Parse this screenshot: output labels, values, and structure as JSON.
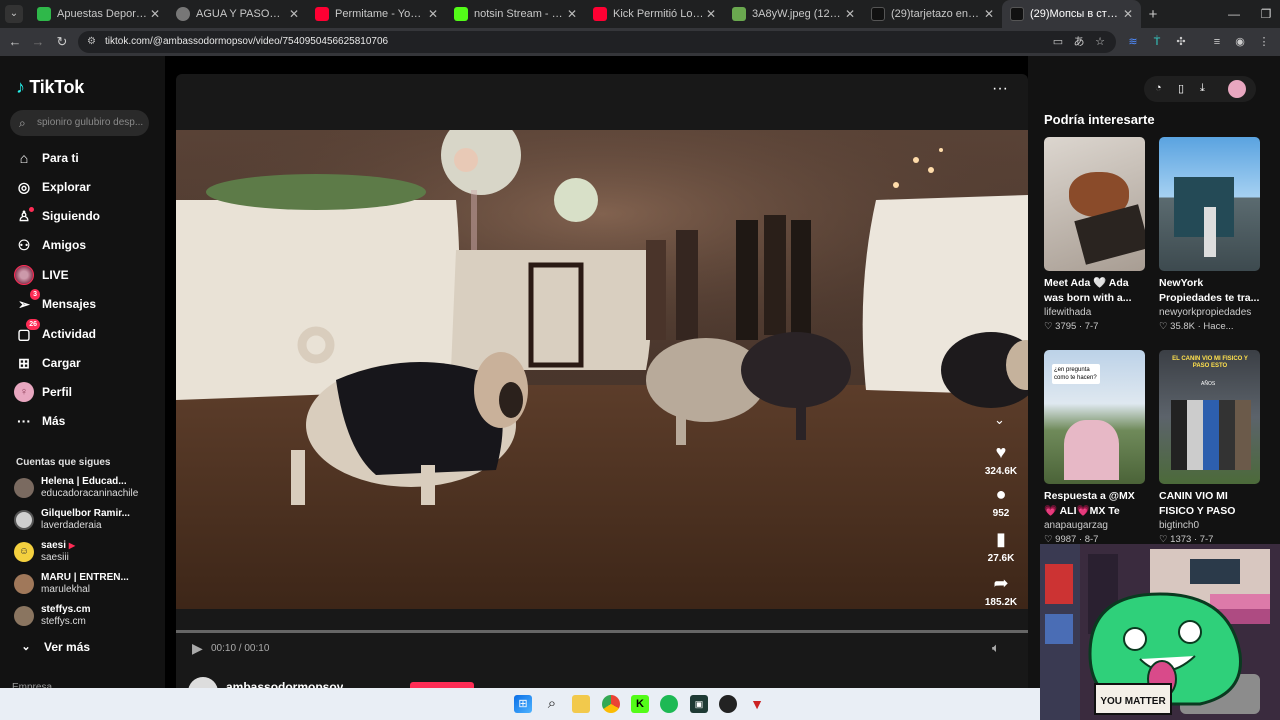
{
  "browser": {
    "tabs": [
      {
        "title": "Apuestas Deportivas Onli",
        "icon": "bet-site-icon",
        "color": "#2fb84a"
      },
      {
        "title": "AGUA Y PASOS DIARIOS",
        "icon": "web-icon",
        "color": "#888888"
      },
      {
        "title": "Permitame - YouTube",
        "icon": "youtube-icon",
        "color": "#ff0033"
      },
      {
        "title": "notsin Stream - Kick Dash",
        "icon": "kick-icon",
        "color": "#53fc18"
      },
      {
        "title": "Kick Permitió Lo Peor - Yo",
        "icon": "youtube-icon",
        "color": "#ff0033"
      },
      {
        "title": "3A8yW.jpeg (1280×720)",
        "icon": "image-icon",
        "color": "#6aa84f"
      },
      {
        "title": "(29)tarjetazo en roblox",
        "icon": "tiktok-icon",
        "color": "#111111"
      },
      {
        "title": "(29)Мопсы в стиле Desp",
        "icon": "tiktok-icon",
        "color": "#111111"
      }
    ],
    "url": "tiktok.com/@ambassodormopsov/video/7540950456625810706"
  },
  "sidebar": {
    "logo": "TikTok",
    "search_placeholder": "spioniro gulubiro desp...",
    "nav": [
      {
        "label": "Para ti",
        "icon": "home-icon"
      },
      {
        "label": "Explorar",
        "icon": "compass-icon"
      },
      {
        "label": "Siguiendo",
        "icon": "following-icon"
      },
      {
        "label": "Amigos",
        "icon": "friends-icon"
      },
      {
        "label": "LIVE",
        "icon": "live-icon"
      },
      {
        "label": "Mensajes",
        "icon": "messages-icon",
        "badge": "3"
      },
      {
        "label": "Actividad",
        "icon": "activity-icon",
        "badge": "26"
      },
      {
        "label": "Cargar",
        "icon": "upload-icon"
      },
      {
        "label": "Perfil",
        "icon": "profile-icon"
      },
      {
        "label": "Más",
        "icon": "more-icon"
      }
    ],
    "following_title": "Cuentas que sigues",
    "accounts": [
      {
        "name": "Helena | Educad...",
        "user": "educadoracaninachile",
        "color": "#7a6a60"
      },
      {
        "name": "Gilquelbor Ramir...",
        "user": "laverdaderaia",
        "color": "#cfcfcf"
      },
      {
        "name": "saesi",
        "user": "saesiii",
        "color": "#f4d03f",
        "live": true
      },
      {
        "name": "MARU | ENTREN...",
        "user": "marulekhal",
        "color": "#a0785a"
      },
      {
        "name": "steffys.cm",
        "user": "steffys.cm",
        "color": "#8a7560"
      }
    ],
    "see_more": "Ver más",
    "footer_partial": "Empresa"
  },
  "video": {
    "time": "00:10 / 00:10",
    "author": "ambassodormopsov",
    "likes": "324.6K",
    "comments": "952",
    "saves": "27.6K",
    "shares": "185.2K"
  },
  "suggestions": {
    "title": "Podría interesarte",
    "cards": [
      {
        "title": "Meet Ada 🤍 Ada was born with a...",
        "user": "lifewithada",
        "stats": "♡ 3795 · 7-7"
      },
      {
        "title": "NewYork Propiedades te tra...",
        "user": "newyorkpropiedades",
        "stats": "♡ 35.8K · Hace..."
      },
      {
        "title": "Respuesta a @MX💗 ALI💗MX Te explico...",
        "user": "anapaugarzag",
        "stats": "♡ 9987 · 8-7"
      },
      {
        "title": "CANIN VIO MI FISICO Y PASO EST...",
        "user": "bigtinch0",
        "stats": "♡ 1373 · 7-7"
      }
    ],
    "thumb_text": {
      "card3": "¿en pregunta como te hacen?",
      "card4": "EL CANIN VIO MI FISICO Y PASO ESTO",
      "card4_sub": "AÑOS"
    }
  },
  "webcam": {
    "sign": "YOU MATTER"
  }
}
